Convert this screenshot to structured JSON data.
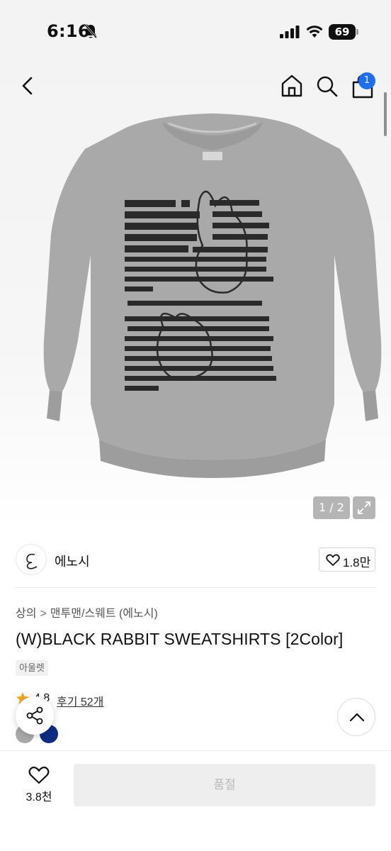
{
  "status_bar": {
    "time": "6:16",
    "battery": "69"
  },
  "nav": {
    "cart_badge": "1"
  },
  "gallery": {
    "counter": "1 / 2"
  },
  "brand": {
    "name": "에노시",
    "likes": "1.8만"
  },
  "breadcrumb": {
    "level1": "상의",
    "level2": "맨투맨/스웨트 (에노시)"
  },
  "product": {
    "title": "(W)BLACK RABBIT SWEATSHIRTS [2Color]",
    "tag": "아울렛",
    "rating": "4.8",
    "reviews": "후기 52개",
    "colors": [
      "#a9a9a9",
      "#0d2d84"
    ]
  },
  "bottom": {
    "wish_count": "3.8천",
    "buy_label": "품절"
  },
  "icons": [
    "back-icon",
    "home-icon",
    "search-icon",
    "cart-icon",
    "expand-icon",
    "heart-icon",
    "star-icon",
    "share-icon",
    "chevron-up-icon"
  ],
  "accent_colors": {
    "badge": "#1d6ef5",
    "star": "#f5a623"
  }
}
